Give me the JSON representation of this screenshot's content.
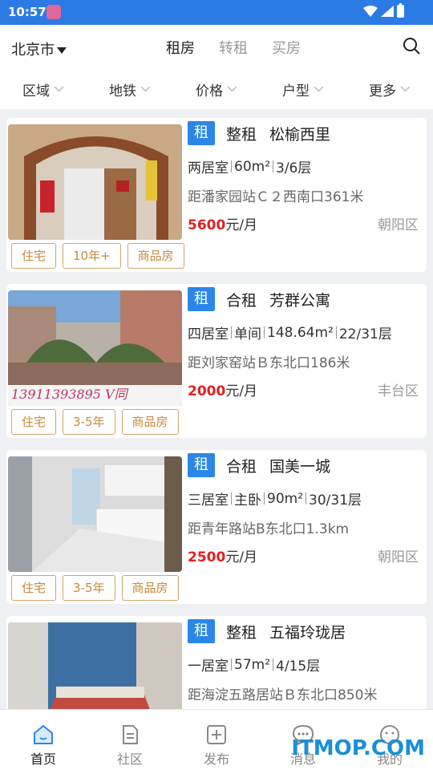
{
  "status_bar": {
    "time": "10:57"
  },
  "header": {
    "city": "北京市",
    "tabs": [
      {
        "label": "租房",
        "active": true
      },
      {
        "label": "转租",
        "active": false
      },
      {
        "label": "买房",
        "active": false
      }
    ]
  },
  "filters": [
    "区域",
    "地铁",
    "价格",
    "户型",
    "更多"
  ],
  "listings": [
    {
      "badge": "租",
      "type": "整租",
      "name": "松榆西里",
      "specs": [
        "两居室",
        "60m²",
        "3/6层"
      ],
      "distance": "距潘家园站Ｃ２西南口361米",
      "price": "5600",
      "price_unit": "元/月",
      "district": "朝阳区",
      "tags": [
        "住宅",
        "10年+",
        "商品房"
      ]
    },
    {
      "badge": "租",
      "type": "合租",
      "name": "芳群公寓",
      "specs": [
        "四居室",
        "单间",
        "148.64m²",
        "22/31层"
      ],
      "distance": "距刘家窑站Ｂ东北口186米",
      "price": "2000",
      "price_unit": "元/月",
      "district": "丰台区",
      "tags": [
        "住宅",
        "3-5年",
        "商品房"
      ],
      "photo_overlay": "13911393895 V同"
    },
    {
      "badge": "租",
      "type": "合租",
      "name": "国美一城",
      "specs": [
        "三居室",
        "主卧",
        "90m²",
        "30/31层"
      ],
      "distance": "距青年路站B东北口1.3km",
      "price": "2500",
      "price_unit": "元/月",
      "district": "朝阳区",
      "tags": [
        "住宅",
        "3-5年",
        "商品房"
      ]
    },
    {
      "badge": "租",
      "type": "整租",
      "name": "五福玲珑居",
      "specs": [
        "一居室",
        "57m²",
        "4/15层"
      ],
      "distance": "距海淀五路居站Ｂ东北口850米",
      "price": "",
      "price_unit": "",
      "district": "",
      "tags": []
    }
  ],
  "bottom_nav": [
    {
      "label": "首页",
      "icon": "home-icon",
      "active": true
    },
    {
      "label": "社区",
      "icon": "community-icon",
      "active": false
    },
    {
      "label": "发布",
      "icon": "publish-icon",
      "active": false
    },
    {
      "label": "消息",
      "icon": "message-icon",
      "active": false
    },
    {
      "label": "我的",
      "icon": "profile-icon",
      "active": false
    }
  ],
  "watermark": "ITMOP.COM",
  "colors": {
    "accent": "#2c7be5",
    "price": "#e02020",
    "tag": "#c8893f"
  }
}
